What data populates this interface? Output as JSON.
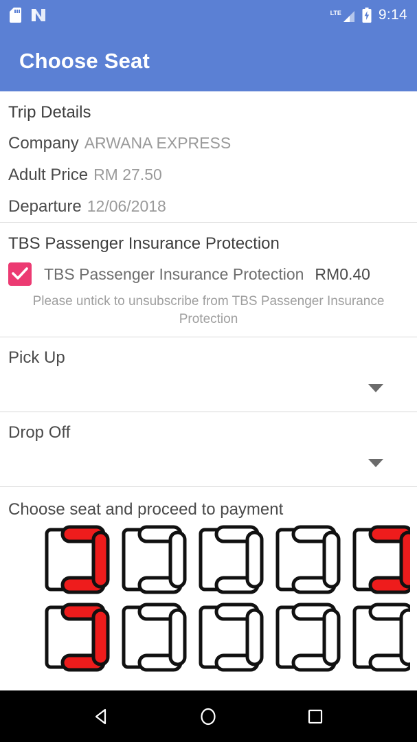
{
  "status_bar": {
    "icons": [
      "sd-card-icon",
      "android-nougat-icon"
    ],
    "network_label": "LTE",
    "signal_icon": "signal-bars-icon",
    "battery_icon": "battery-charging-icon",
    "time": "9:14"
  },
  "app_bar": {
    "title": "Choose Seat",
    "background_color": "#5B80D4"
  },
  "trip_details": {
    "heading": "Trip Details",
    "rows": [
      {
        "key": "Company",
        "value": "ARWANA EXPRESS"
      },
      {
        "key": "Adult Price",
        "value": "RM 27.50"
      },
      {
        "key": "Departure",
        "value": "12/06/2018"
      }
    ]
  },
  "insurance": {
    "heading": "TBS Passenger Insurance Protection",
    "checkbox_checked": true,
    "checkbox_color": "#EC3A72",
    "option_label": "TBS Passenger Insurance Protection",
    "option_price": "RM0.40",
    "note": "Please untick to unsubscribe from TBS Passenger Insurance Protection"
  },
  "pick_up": {
    "label": "Pick Up",
    "value": "",
    "caret_icon": "chevron-down-icon"
  },
  "drop_off": {
    "label": "Drop Off",
    "value": "",
    "caret_icon": "chevron-down-icon"
  },
  "seats": {
    "heading": "Choose seat and proceed to payment",
    "selected_color": "#EE1C1C",
    "available_color": "#FFFFFF",
    "rows": [
      {
        "seats": [
          {
            "id": "r1s1",
            "selected": true
          },
          {
            "id": "r1s2",
            "selected": false
          },
          {
            "id": "r1s3",
            "selected": false
          },
          {
            "id": "r1s4",
            "selected": false
          },
          {
            "id": "r1s5",
            "selected": true
          }
        ]
      },
      {
        "seats": [
          {
            "id": "r2s1",
            "selected": true
          },
          {
            "id": "r2s2",
            "selected": false
          },
          {
            "id": "r2s3",
            "selected": false
          },
          {
            "id": "r2s4",
            "selected": false
          },
          {
            "id": "r2s5",
            "selected": false
          }
        ]
      }
    ]
  },
  "nav_bar": {
    "back_label": "back-icon",
    "home_label": "home-icon",
    "recents_label": "recents-icon"
  }
}
